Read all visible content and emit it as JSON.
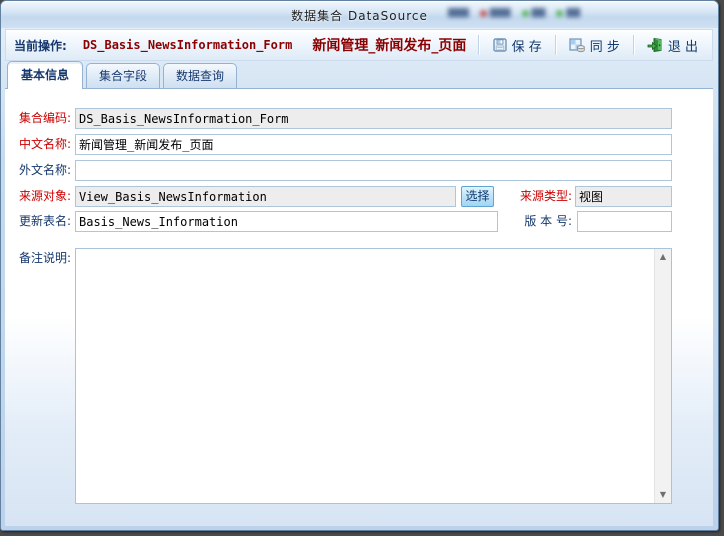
{
  "window": {
    "title": "数据集合  DataSource"
  },
  "titlebar": {
    "redacted_badges": [
      {
        "dot": "none",
        "blob": "▇▇▇"
      },
      {
        "dot": "red",
        "blob": "▇▇▇"
      },
      {
        "dot": "green",
        "blob": "▇▇"
      },
      {
        "dot": "green",
        "blob": "▇▇"
      }
    ]
  },
  "toolbar": {
    "current_op_label": "当前操作:",
    "operation_code": "DS_Basis_NewsInformation_Form",
    "operation_name": "新闻管理_新闻发布_页面",
    "save_label": "保 存",
    "sync_label": "同 步",
    "exit_label": "退 出"
  },
  "tabs": [
    {
      "label": "基本信息",
      "active": true
    },
    {
      "label": "集合字段",
      "active": false
    },
    {
      "label": "数据查询",
      "active": false
    }
  ],
  "form": {
    "code_label": "集合编码:",
    "code_value": "DS_Basis_NewsInformation_Form",
    "cn_name_label": "中文名称:",
    "cn_name_value": "新闻管理_新闻发布_页面",
    "foreign_name_label": "外文名称:",
    "foreign_name_value": "",
    "source_object_label": "来源对象:",
    "source_object_value": "View_Basis_NewsInformation",
    "select_button_label": "选择",
    "source_type_label": "来源类型:",
    "source_type_value": "视图",
    "update_table_label": "更新表名:",
    "update_table_value": "Basis_News_Information",
    "version_label": "版 本 号:",
    "version_value": "",
    "remark_label": "备注说明:",
    "remark_value": ""
  },
  "icons": {
    "save": "floppy-disk-icon",
    "sync": "sync-grid-database-icon",
    "exit": "exit-door-icon",
    "scroll_up": "▲",
    "scroll_down": "▼"
  },
  "colors": {
    "required_label": "#cc0000",
    "optional_label": "#16386e",
    "operation_text": "#8b0000",
    "readonly_bg": "#ededed",
    "frame": "#bcd2ea",
    "select_button_bg": "#bfe4f8"
  }
}
